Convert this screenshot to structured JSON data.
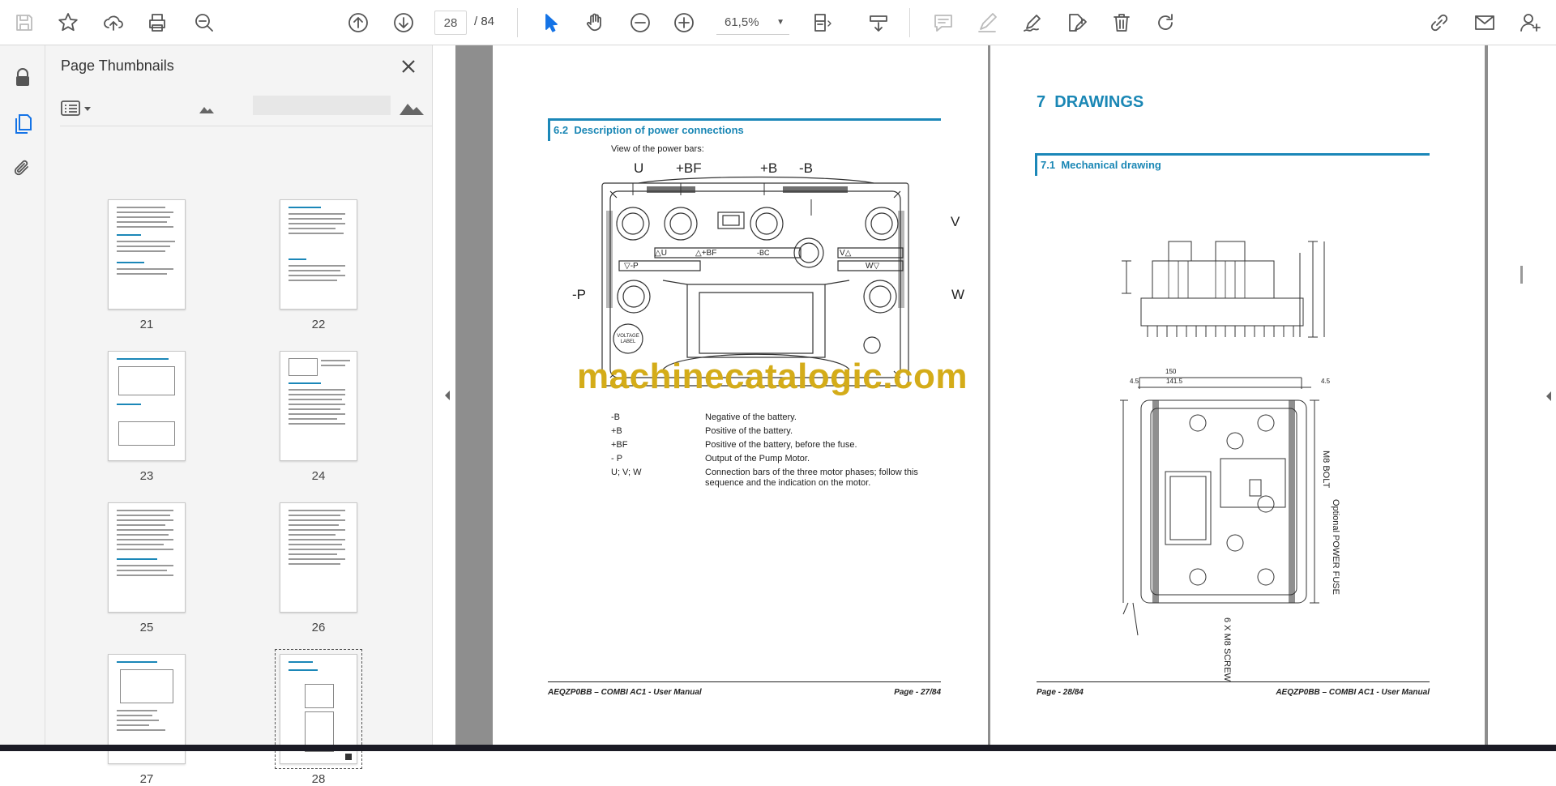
{
  "toolbar": {
    "page_current": "28",
    "page_total": "/ 84",
    "zoom": "61,5%"
  },
  "panel": {
    "title": "Page Thumbnails"
  },
  "thumbnails": [
    {
      "label": "21"
    },
    {
      "label": "22"
    },
    {
      "label": "23"
    },
    {
      "label": "24"
    },
    {
      "label": "25"
    },
    {
      "label": "26"
    },
    {
      "label": "27"
    },
    {
      "label": "28"
    }
  ],
  "page27": {
    "section_number": "6.2",
    "section_title": "Description of power connections",
    "intro": "View of the power bars:",
    "callouts": {
      "u": "U",
      "bf": "+BF",
      "b_plus": "+B",
      "b_minus": "-B",
      "v": "V",
      "p": "-P",
      "w": "W"
    },
    "device_labels": {
      "au": "△U",
      "abf": "△+BF",
      "bc": "-BC",
      "va": "V△",
      "vp": "▽-P",
      "wv": "W▽",
      "voltage": "VOLTAGE LABEL"
    },
    "legend": [
      {
        "key": "-B",
        "value": "Negative of the battery."
      },
      {
        "key": "+B",
        "value": "Positive of the battery."
      },
      {
        "key": "+BF",
        "value": "Positive of the battery, before the fuse."
      },
      {
        "key": "- P",
        "value": "Output of the Pump Motor."
      },
      {
        "key": "U; V; W",
        "value": "Connection bars of the three motor phases; follow this sequence and the indication on the motor."
      }
    ],
    "footer_left": "AEQZP0BB – COMBI AC1 - User Manual",
    "footer_right": "Page - 27/84"
  },
  "page28": {
    "chapter_number": "7",
    "chapter_title": "DRAWINGS",
    "section_number": "7.1",
    "section_title": "Mechanical drawing",
    "dims": {
      "w150": "150",
      "w141": "141.5",
      "s45a": "4.5",
      "s45b": "4.5",
      "m8bolt": "M8 BOLT",
      "fuse": "Optional POWER FUSE",
      "screw": "6 X M8 SCREW"
    },
    "footer_left": "Page - 28/84",
    "footer_right": "AEQZP0BB – COMBI AC1 - User Manual"
  },
  "watermark": "machinecatalogic.com"
}
